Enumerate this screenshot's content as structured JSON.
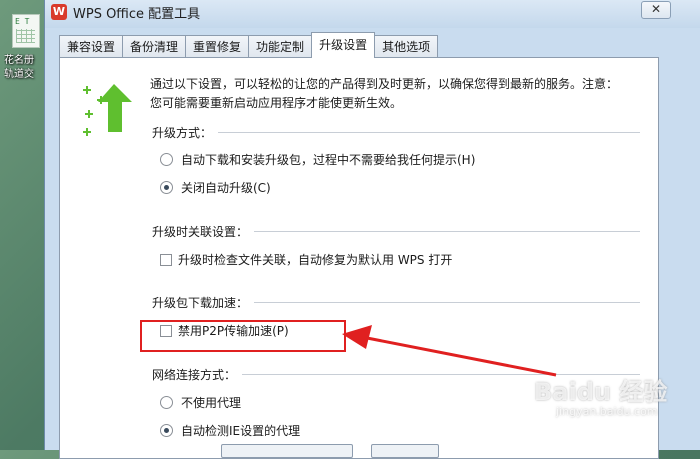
{
  "desktop": {
    "icon_badge": "E T",
    "label_line1": "花名册",
    "label_line2": "轨道交"
  },
  "window": {
    "title": "WPS Office 配置工具",
    "app_icon_glyph": "W",
    "close_glyph": "✕"
  },
  "tabs": [
    {
      "label": "兼容设置",
      "active": false
    },
    {
      "label": "备份清理",
      "active": false
    },
    {
      "label": "重置修复",
      "active": false
    },
    {
      "label": "功能定制",
      "active": false
    },
    {
      "label": "升级设置",
      "active": true
    },
    {
      "label": "其他选项",
      "active": false
    }
  ],
  "intro": {
    "line1": "通过以下设置，可以轻松的让您的产品得到及时更新，以确保您得到最新的服务。注意：",
    "line2": "您可能需要重新启动应用程序才能使更新生效。"
  },
  "sections": {
    "upgrade_mode": {
      "heading": "升级方式：",
      "options": [
        {
          "label": "自动下载和安装升级包，过程中不需要给我任何提示(H)",
          "selected": false
        },
        {
          "label": "关闭自动升级(C)",
          "selected": true
        }
      ]
    },
    "association": {
      "heading": "升级时关联设置：",
      "checkbox": {
        "label": "升级时检查文件关联，自动修复为默认用 WPS 打开",
        "checked": false
      }
    },
    "download_accel": {
      "heading": "升级包下载加速：",
      "checkbox": {
        "label": "禁用P2P传输加速(P)",
        "checked": false
      }
    },
    "network": {
      "heading": "网络连接方式：",
      "options": [
        {
          "label": "不使用代理",
          "selected": false
        },
        {
          "label": "自动检测IE设置的代理",
          "selected": true
        }
      ]
    }
  },
  "annotation": {
    "highlight_color": "#e02020"
  },
  "watermark": {
    "brand": "Baidu 经验",
    "url": "jingyan.baidu.com"
  },
  "colors": {
    "window_frame": "#c9dcef",
    "panel": "#ffffff",
    "accent_green": "#5fbf2f"
  }
}
